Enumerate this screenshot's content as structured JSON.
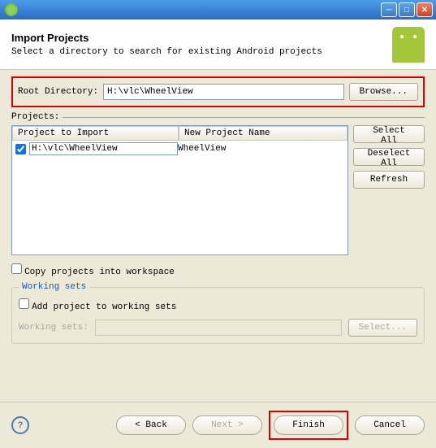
{
  "header": {
    "title": "Import Projects",
    "subtitle": "Select a directory to search for existing Android projects"
  },
  "root": {
    "label": "Root Directory:",
    "value": "H:\\vlc\\WheelView",
    "browse": "Browse..."
  },
  "projects": {
    "legend": "Projects:",
    "col1": "Project to Import",
    "col2": "New Project Name",
    "rows": [
      {
        "checked": true,
        "path": "H:\\vlc\\WheelView",
        "name": "WheelView"
      }
    ],
    "select_all": "Select All",
    "deselect_all": "Deselect All",
    "refresh": "Refresh"
  },
  "copy_label": "Copy projects into workspace",
  "working_sets": {
    "legend": "Working sets",
    "add_label": "Add project to working sets",
    "ws_label": "Working sets:",
    "select": "Select..."
  },
  "footer": {
    "back": "< Back",
    "next": "Next >",
    "finish": "Finish",
    "cancel": "Cancel"
  }
}
